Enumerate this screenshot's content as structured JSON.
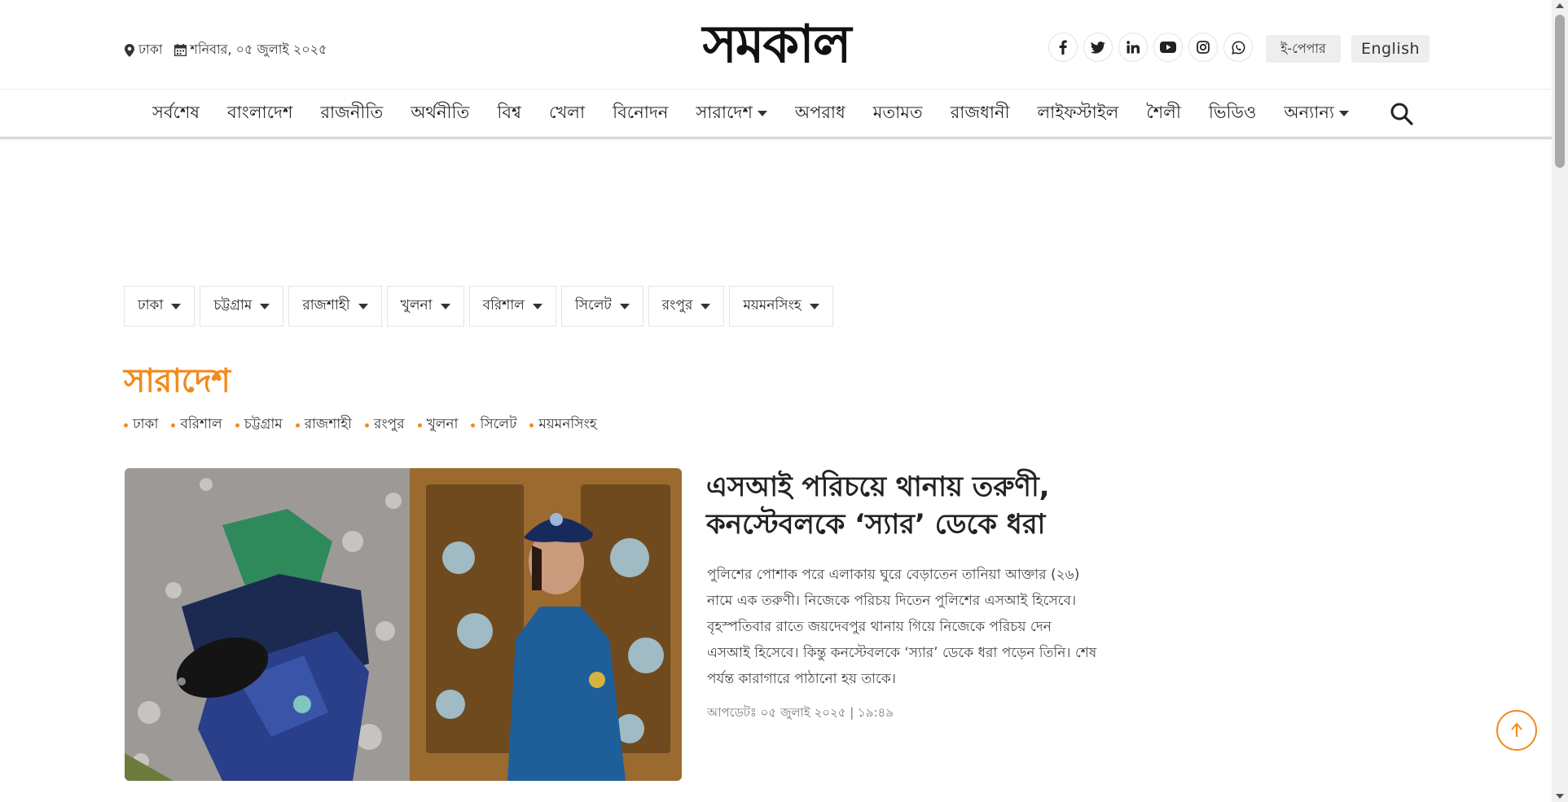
{
  "header": {
    "location": "ঢাকা",
    "date": "শনিবার, ০৫ জুলাই ২০২৫",
    "logo_text": "সমকাল",
    "social_icons": [
      "facebook-icon",
      "twitter-icon",
      "linkedin-icon",
      "youtube-icon",
      "instagram-icon",
      "whatsapp-icon"
    ],
    "epaper_label": "ই-পেপার",
    "english_label": "English"
  },
  "nav": {
    "items": [
      {
        "label": "সর্বশেষ",
        "dropdown": false
      },
      {
        "label": "বাংলাদেশ",
        "dropdown": false
      },
      {
        "label": "রাজনীতি",
        "dropdown": false
      },
      {
        "label": "অর্থনীতি",
        "dropdown": false
      },
      {
        "label": "বিশ্ব",
        "dropdown": false
      },
      {
        "label": "খেলা",
        "dropdown": false
      },
      {
        "label": "বিনোদন",
        "dropdown": false
      },
      {
        "label": "সারাদেশ",
        "dropdown": true
      },
      {
        "label": "অপরাধ",
        "dropdown": false
      },
      {
        "label": "মতামত",
        "dropdown": false
      },
      {
        "label": "রাজধানী",
        "dropdown": false
      },
      {
        "label": "লাইফস্টাইল",
        "dropdown": false
      },
      {
        "label": "শৈলী",
        "dropdown": false
      },
      {
        "label": "ভিডিও",
        "dropdown": false
      },
      {
        "label": "অন্যান্য",
        "dropdown": true
      }
    ]
  },
  "divisions": [
    "ঢাকা",
    "চট্টগ্রাম",
    "রাজশাহী",
    "খুলনা",
    "বরিশাল",
    "সিলেট",
    "রংপুর",
    "ময়মনসিংহ"
  ],
  "section": {
    "title": "সারাদেশ",
    "subcategories": [
      "ঢাকা",
      "বরিশাল",
      "চট্টগ্রাম",
      "রাজশাহী",
      "রংপুর",
      "খুলনা",
      "সিলেট",
      "ময়মনসিংহ"
    ]
  },
  "lead": {
    "title": "এসআই পরিচয়ে থানায় তরুণী, কনস্টেবলকে ‘স্যার’ ডেকে ধরা",
    "summary": "পুলিশের পোশাক পরে এলাকায় ঘুরে বেড়াতেন তানিয়া আক্তার (২৬) নামে এক তরুণী। নিজেকে পরিচয় দিতেন পুলিশের এসআই হিসেবে। বৃহস্পতিবার রাতে জয়দেবপুর থানায় গিয়ে নিজেকে পরিচয় দেন এসআই হিসেবে। কিন্তু কনস্টেবলকে ‘স্যার’ ডেকে ধরা পড়েন তিনি। শেষ পর্যন্ত কারাগারে পাঠানো হয় তাকে।",
    "updated": "আপডেটঃ ০৫ জুলাই ২০২৫ | ১৯:৪৯"
  },
  "colors": {
    "accent": "#f28a1b",
    "text": "#222222",
    "muted": "#777777"
  }
}
